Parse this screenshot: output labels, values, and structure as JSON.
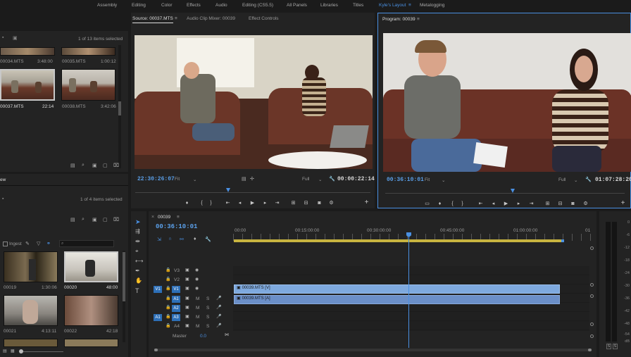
{
  "workspace": {
    "tabs": [
      "Assembly",
      "Editing",
      "Color",
      "Effects",
      "Audio",
      "Editing (CS5.5)",
      "All Panels",
      "Libraries",
      "Titles",
      "Kyle's Layout",
      "Metalogging"
    ],
    "active": "Kyle's Layout",
    "menu_icon": "≡"
  },
  "project": {
    "items_selected": "1 of 13 items selected",
    "clips": [
      {
        "name": "00034.MTS",
        "duration": "3:48:00"
      },
      {
        "name": "00035.MTS",
        "duration": "1:00:12"
      },
      {
        "name": "00037.MTS",
        "duration": "22:14"
      },
      {
        "name": "00038.MTS",
        "duration": "3:42:06"
      }
    ]
  },
  "media_browser": {
    "title_fragment": "ew",
    "items_selected": "1 of 4 items selected",
    "ingest_label": "Ingest",
    "search_placeholder": "",
    "clips": [
      {
        "name": "00019",
        "duration": "1:30:06"
      },
      {
        "name": "00020",
        "duration": "48:00"
      },
      {
        "name": "00021",
        "duration": "4:13:11"
      },
      {
        "name": "00022",
        "duration": "42:18"
      }
    ]
  },
  "source": {
    "tabs": [
      "Source: 00037.MTS",
      "Audio Clip Mixer: 00039",
      "Effect Controls"
    ],
    "timecode": "22:30:26:07",
    "fit": "Fit",
    "quality": "Full",
    "duration": "00:00:22:14"
  },
  "program": {
    "title": "Program: 00039",
    "timecode": "00:36:10:01",
    "fit": "Fit",
    "quality": "Full",
    "duration": "01:07:28:20"
  },
  "timeline": {
    "sequence": "00039",
    "timecode": "00:36:10:01",
    "ruler": [
      "00:00",
      "00:15:00:00",
      "00:30:00:00",
      "00:45:00:00",
      "01:00:00:00",
      "01"
    ],
    "tracks": [
      {
        "target": "",
        "name": "V3"
      },
      {
        "target": "",
        "name": "V2"
      },
      {
        "target": "V1",
        "name": "V1"
      },
      {
        "target": "",
        "name": "A1"
      },
      {
        "target": "",
        "name": "A2"
      },
      {
        "target": "A1",
        "name": "A3"
      },
      {
        "target": "",
        "name": "A4"
      }
    ],
    "master_label": "Master",
    "master_value": "0.0",
    "video_clip": "00039.MTS [V]",
    "audio_clip": "00039.MTS [A]"
  },
  "meters": {
    "ticks": [
      "0",
      "-6",
      "-12",
      "-18",
      "-24",
      "-30",
      "-36",
      "-42",
      "-48",
      "-54"
    ],
    "db_label": "dB",
    "solo_labels": [
      "S",
      "S"
    ]
  },
  "colors": {
    "accent": "#4a90e2",
    "clip_video": "#7ea9de",
    "clip_audio": "#6b8fc8",
    "playhead": "#4a90e2"
  }
}
